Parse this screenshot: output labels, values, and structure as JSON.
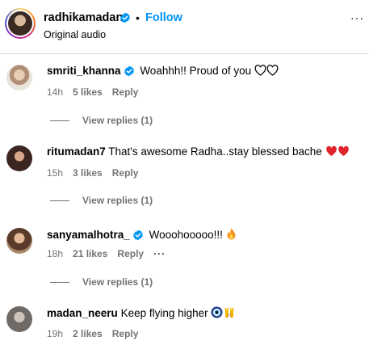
{
  "header": {
    "username": "radhikamadan",
    "follow_label": "Follow",
    "dot": "•",
    "subtitle": "Original audio",
    "more": "···"
  },
  "comments": [
    {
      "username": "smriti_khanna",
      "verified": true,
      "text": "Woahhh!! Proud of you",
      "emoji": [
        "white-heart",
        "white-heart"
      ],
      "time": "14h",
      "likes": "5 likes",
      "reply": "Reply",
      "view_replies": "View replies (1)"
    },
    {
      "username": "ritumadan7",
      "verified": false,
      "text": "That's awesome Radha..stay blessed bache",
      "emoji": [
        "red-heart",
        "red-heart"
      ],
      "time": "15h",
      "likes": "3 likes",
      "reply": "Reply",
      "view_replies": "View replies (1)"
    },
    {
      "username": "sanyamalhotra_",
      "verified": true,
      "text": "Woooh",
      "text_full": "Wooohooooo!!!",
      "emoji": [
        "fire"
      ],
      "time": "18h",
      "likes": "21 likes",
      "reply": "Reply",
      "options": "···",
      "view_replies": "View replies (1)"
    },
    {
      "username": "madan_neeru",
      "verified": false,
      "text": "Keep flying higher",
      "emoji": [
        "nazar-amulet",
        "raising-hands"
      ],
      "time": "19h",
      "likes": "2 likes",
      "reply": "Reply"
    }
  ],
  "colors": {
    "accent": "#0095f6",
    "muted": "#737373",
    "heart_red": "#ed4956"
  }
}
